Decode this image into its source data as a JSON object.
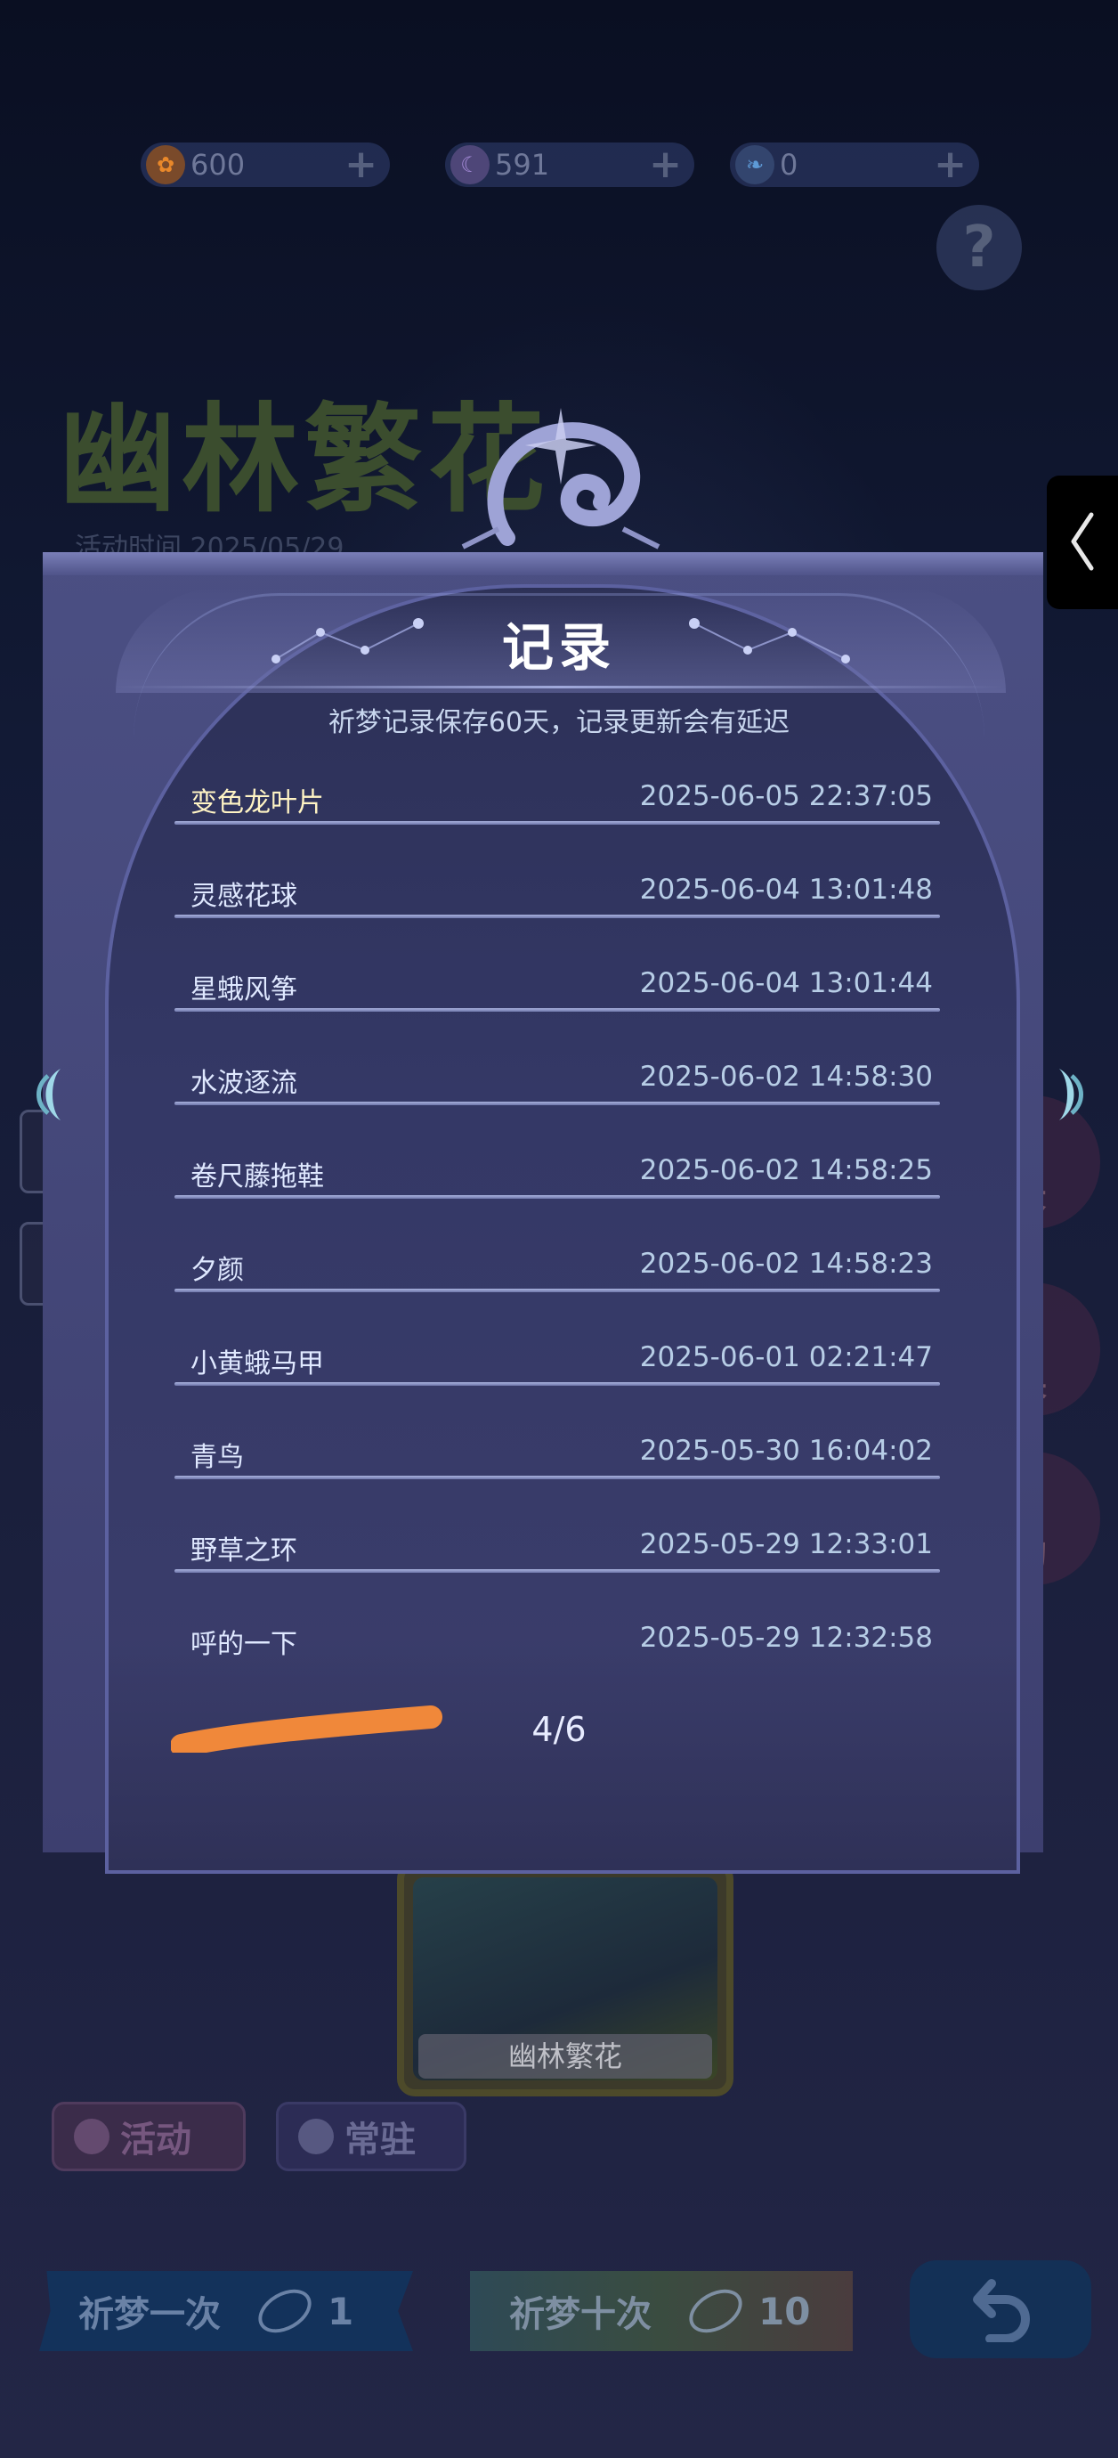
{
  "currencies": [
    {
      "name": "flower-coin",
      "value": "600",
      "color": "#e9882a"
    },
    {
      "name": "moon-coin",
      "value": "591",
      "color": "#a58bd8"
    },
    {
      "name": "feather-coin",
      "value": "0",
      "color": "#5d9ad6"
    }
  ],
  "background": {
    "event_title": "幽林繁花",
    "event_title_small": "繁花",
    "event_time": "活动时间 2025/05/29",
    "right_labels": [
      "录",
      "换",
      "励"
    ],
    "thumbnail_label": "幽林繁花",
    "tabs": {
      "activity": "活动",
      "permanent": "常驻"
    },
    "pray_once": {
      "label": "祈梦一次",
      "count": "1"
    },
    "pray_ten": {
      "label": "祈梦十次",
      "count": "10"
    }
  },
  "modal": {
    "title": "记录",
    "subtitle": "祈梦记录保存60天，记录更新会有延迟",
    "records": [
      {
        "name": "变色龙叶片",
        "time": "2025-06-05 22:37:05"
      },
      {
        "name": "灵感花球",
        "time": "2025-06-04 13:01:48"
      },
      {
        "name": "星蛾风筝",
        "time": "2025-06-04 13:01:44"
      },
      {
        "name": "水波逐流",
        "time": "2025-06-02 14:58:30"
      },
      {
        "name": "卷尺藤拖鞋",
        "time": "2025-06-02 14:58:25"
      },
      {
        "name": "夕颜",
        "time": "2025-06-02 14:58:23"
      },
      {
        "name": "小黄蛾马甲",
        "time": "2025-06-01 02:21:47"
      },
      {
        "name": "青鸟",
        "time": "2025-05-30 16:04:02"
      },
      {
        "name": "野草之环",
        "time": "2025-05-29 12:33:01"
      },
      {
        "name": "呼的一下",
        "time": "2025-05-29 12:32:58"
      }
    ],
    "pager": "4/6"
  },
  "colors": {
    "accent_arrow": "#9fd8e8",
    "scribble": "#f0883a",
    "highlight_name": "#fff4c4"
  }
}
